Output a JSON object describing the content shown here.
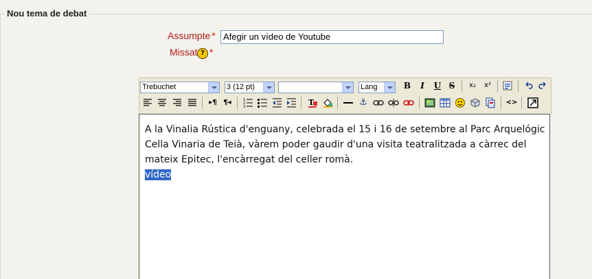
{
  "form": {
    "legend": "Nou tema de debat",
    "subject_label": "Assumpte",
    "subject_value": "Afegir un vídeo de Youtube",
    "message_label": "Missatge",
    "required_mark": "*",
    "help_glyph": "?"
  },
  "toolbar": {
    "font_family": "Trebuchet",
    "font_size": "3 (12 pt)",
    "heading": "",
    "lang": "Lang",
    "bold": "B",
    "italic": "I",
    "underline": "U",
    "strike": "S",
    "subscript": "x₂",
    "superscript": "x²",
    "code": "<>"
  },
  "editor": {
    "text": "A la Vinalia Rústica d'enguany, celebrada el 15 i 16 de setembre al Parc Arquelógic Cella Vinaria de Teià, vàrem poder gaudir d'una visita teatralitzada a càrrec del mateix Epitec, l'encàrregat del celler romà.",
    "selected_word": "vídeo"
  }
}
